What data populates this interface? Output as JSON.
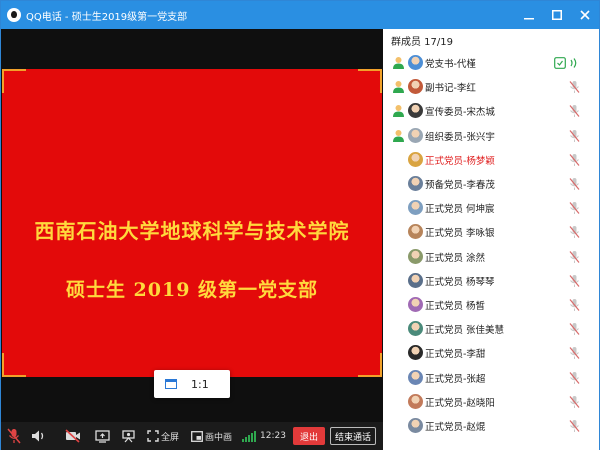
{
  "window": {
    "title": "QQ电话 - 硕士生2019级第一党支部"
  },
  "slide": {
    "line1": "西南石油大学地球科学与技术学院",
    "line2": "硕士生 2019 级第一党支部"
  },
  "ratio_popup": {
    "label": "1:1"
  },
  "toolbar": {
    "fullscreen_label": "全屏",
    "pip_label": "画中画",
    "timer": "12:23",
    "exit_label": "退出",
    "end_call_label": "结束通话"
  },
  "members": {
    "header": "群成员 17/19",
    "items": [
      {
        "name": "党支书-代槿",
        "highlight": false,
        "active": true
      },
      {
        "name": "副书记-李红",
        "highlight": false,
        "active": false
      },
      {
        "name": "宣传委员-宋杰城",
        "highlight": false,
        "active": false
      },
      {
        "name": "组织委员-张兴宇",
        "highlight": false,
        "active": false
      },
      {
        "name": "正式党员-杨梦颖",
        "highlight": true,
        "active": false
      },
      {
        "name": "预备党员-李春茂",
        "highlight": false,
        "active": false
      },
      {
        "name": "正式党员 何坤宸",
        "highlight": false,
        "active": false
      },
      {
        "name": "正式党员 李咏银",
        "highlight": false,
        "active": false
      },
      {
        "name": "正式党员 涂然",
        "highlight": false,
        "active": false
      },
      {
        "name": "正式党员 杨琴琴",
        "highlight": false,
        "active": false
      },
      {
        "name": "正式党员 杨皙",
        "highlight": false,
        "active": false
      },
      {
        "name": "正式党员 张佳美慧",
        "highlight": false,
        "active": false
      },
      {
        "name": "正式党员-李甜",
        "highlight": false,
        "active": false
      },
      {
        "name": "正式党员-张超",
        "highlight": false,
        "active": false
      },
      {
        "name": "正式党员-赵晓阳",
        "highlight": false,
        "active": false
      },
      {
        "name": "正式党员-赵焜",
        "highlight": false,
        "active": false
      }
    ]
  },
  "colors": {
    "titlebar": "#2a8fe2",
    "slide_bg": "#e30a0a",
    "slide_text": "#ffd93d",
    "slide_corner": "#f2a12a",
    "highlight_name": "#e02020",
    "exit_button": "#e23a3a",
    "active_green": "#2fa84f"
  }
}
